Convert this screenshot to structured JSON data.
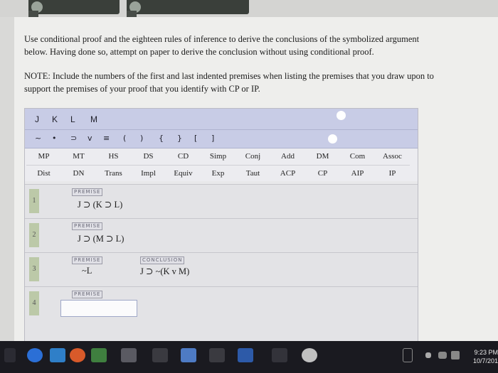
{
  "instructions": {
    "main_line1": "Use conditional proof and the eighteen rules of inference to derive the conclusions of the symbolized argument",
    "main_line2": "below. Having done so, attempt on paper to derive the conclusion without using conditional proof.",
    "note_line1": "NOTE: Include the numbers of the first and last indented premises when listing the premises that you draw upon to",
    "note_line2": "support the premises of your proof that you identify with CP or IP."
  },
  "variables": [
    "J",
    "K",
    "L",
    "M"
  ],
  "symbols": [
    "~",
    "•",
    "⊃",
    "v",
    "≡",
    "(",
    ")",
    "{",
    "}",
    "[",
    "]"
  ],
  "rules_row1": [
    "MP",
    "MT",
    "HS",
    "DS",
    "CD",
    "Simp",
    "Conj",
    "Add",
    "DM",
    "Com",
    "Assoc"
  ],
  "rules_row2": [
    "Dist",
    "DN",
    "Trans",
    "Impl",
    "Equiv",
    "Exp",
    "Taut",
    "ACP",
    "CP",
    "AIP",
    "IP"
  ],
  "proof": {
    "rows": [
      {
        "num": "1",
        "label": "PREMISE",
        "formula": "J ⊃ (K ⊃ L)"
      },
      {
        "num": "2",
        "label": "PREMISE",
        "formula": "J ⊃ (M ⊃ L)"
      },
      {
        "num": "3",
        "label": "PREMISE",
        "formula": "~L",
        "conclusion_label": "CONCLUSION",
        "conclusion": "J ⊃ ~(K v M)"
      },
      {
        "num": "4",
        "label": "PREMISE",
        "input_value": ""
      }
    ]
  },
  "taskbar": {
    "time": "9:23 PM",
    "date": "10/7/201"
  },
  "colors": {
    "toolbar_blue": "#c8cce6",
    "rownum_green": "#bcc9a8",
    "page_bg": "#eeeeec"
  }
}
